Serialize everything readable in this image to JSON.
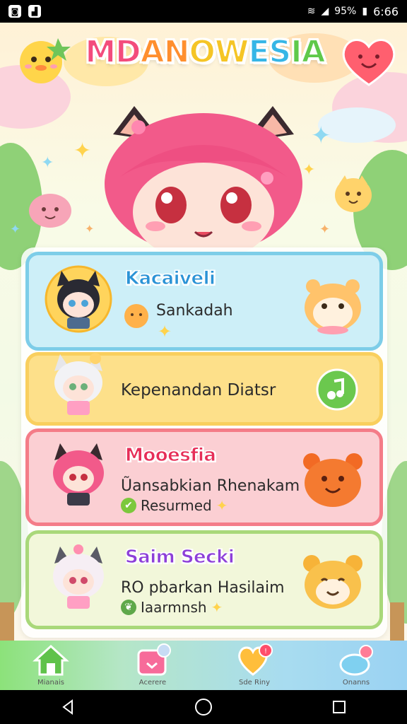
{
  "status_bar": {
    "battery": "95%",
    "time": "6:66"
  },
  "header": {
    "title_parts": [
      "MD",
      "AN",
      "OW",
      "ES",
      "IA"
    ],
    "title": "MDANOWESIA"
  },
  "cards": [
    {
      "title": "Kacaiveli",
      "line1": "Sankadah",
      "bg": "#cdeff8",
      "border": "#7dcde8"
    },
    {
      "line1": "Kepenandan Diatsr",
      "bg": "#fde08a",
      "border": "#f9cf5e"
    },
    {
      "title": "Mooesfia",
      "line1": "Ũansabkian Rhenakam",
      "status": "Resurmed",
      "bg": "#fbcfd3",
      "border": "#f47c88"
    },
    {
      "title": "Saim Secki",
      "line1": "RO pbarkan Hasilaim",
      "status": "Iaarmnsh",
      "bg": "#f2f7da",
      "border": "#a9d87a"
    }
  ],
  "bottom_nav": [
    {
      "label": "Mianais",
      "icon": "home-icon"
    },
    {
      "label": "Acerere",
      "icon": "calendar-icon"
    },
    {
      "label": "Sde Riny",
      "icon": "heart-icon"
    },
    {
      "label": "Onanns",
      "icon": "cloud-icon"
    }
  ],
  "colors": {
    "nav_gradient_start": "#8ce27a",
    "nav_gradient_end": "#9ad2f2",
    "card1_title": "#2b93d6",
    "card3_title": "#e62e58",
    "card4_title": "#8d3fd8"
  }
}
